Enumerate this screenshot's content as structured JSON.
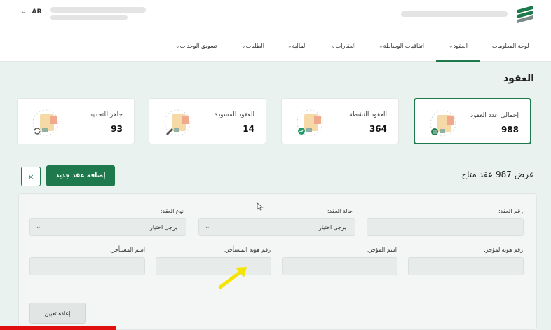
{
  "header": {
    "language": "AR"
  },
  "nav": {
    "items": [
      {
        "label": "لوحة المعلومات",
        "has_caret": false
      },
      {
        "label": "العقود",
        "has_caret": true,
        "active": true
      },
      {
        "label": "اتفاقيات الوساطة",
        "has_caret": true
      },
      {
        "label": "العقارات",
        "has_caret": true
      },
      {
        "label": "المالية",
        "has_caret": true
      },
      {
        "label": "الطلبات",
        "has_caret": true
      },
      {
        "label": "تسويق الوحدات",
        "has_caret": true
      }
    ]
  },
  "page": {
    "title": "العقود",
    "results": "عرض 987 عقد متاح"
  },
  "stats": [
    {
      "label": "إجمالي عدد العقود",
      "value": "988",
      "active": true,
      "badge": "list-icon"
    },
    {
      "label": "العقود النشطة",
      "value": "364",
      "active": false,
      "badge": "check-icon"
    },
    {
      "label": "العقود المسودة",
      "value": "14",
      "active": false,
      "badge": "pencil-icon"
    },
    {
      "label": "جاهز للتجديد",
      "value": "93",
      "active": false,
      "badge": "refresh-icon"
    }
  ],
  "buttons": {
    "add": "إضافة عقد جديد",
    "close": "×",
    "reset": "إعادة تعيين"
  },
  "filters": {
    "contract_number": {
      "label": "رقم العقد:"
    },
    "contract_status": {
      "label": "حالة العقد:",
      "placeholder": "يرجى اختيار"
    },
    "contract_type": {
      "label": "نوع العقد:",
      "placeholder": "يرجى اختيار"
    },
    "lessor_id": {
      "label": "رقم هويةالمؤجر:"
    },
    "lessor_name": {
      "label": "اسم المؤجر:"
    },
    "tenant_id": {
      "label": "رقم هوية المستأجر:"
    },
    "tenant_name": {
      "label": "اسم المستأجر:"
    }
  },
  "colors": {
    "primary": "#1e7a4c",
    "background": "#eaf2f0",
    "annotation_arrow": "#f5e400",
    "video_progress": "#e01010"
  },
  "video_progress": 0.21
}
